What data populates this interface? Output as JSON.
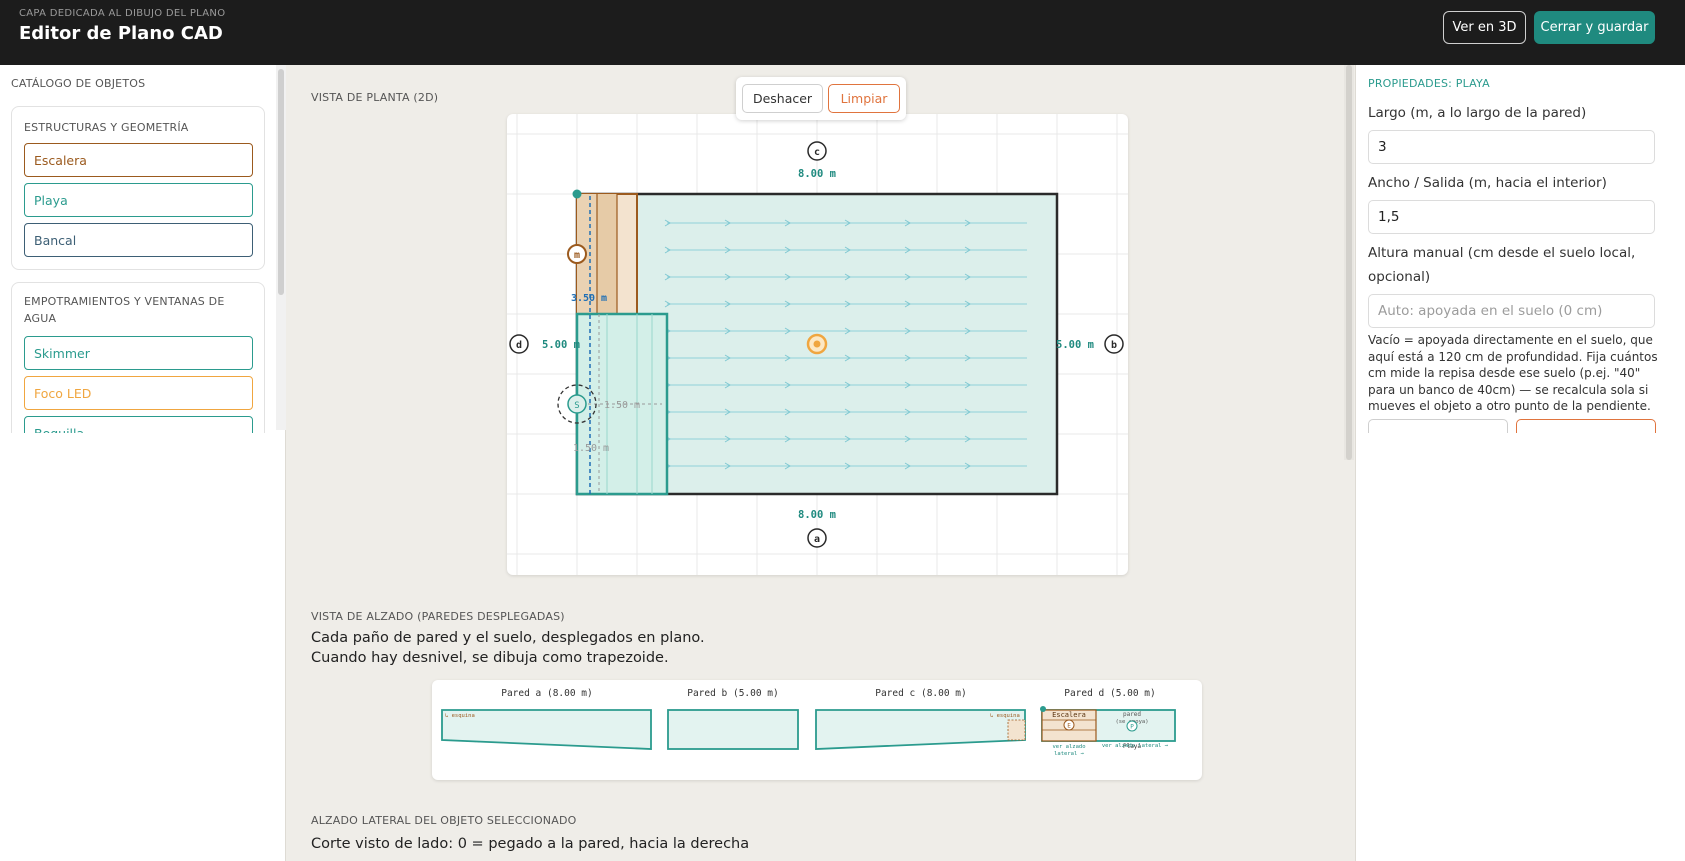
{
  "header": {
    "subtitle": "CAPA DEDICADA AL DIBUJO DEL PLANO",
    "title": "Editor de Plano CAD",
    "view_3d_label": "Ver en 3D",
    "save_label": "Cerrar y guardar"
  },
  "catalog": {
    "title": "CATÁLOGO DE OBJETOS",
    "groups": [
      {
        "title": "ESTRUCTURAS Y GEOMETRÍA",
        "items": [
          {
            "label": "Escalera",
            "color": "#9b5a1e"
          },
          {
            "label": "Playa",
            "color": "#2b9b8e"
          },
          {
            "label": "Bancal",
            "color": "#3d5f75"
          }
        ]
      },
      {
        "title": "EMPOTRAMIENTOS Y VENTANAS DE AGUA",
        "items": [
          {
            "label": "Skimmer",
            "color": "#2b9b8e"
          },
          {
            "label": "Foco LED",
            "color": "#f0a640"
          },
          {
            "label": "Boquilla",
            "color": "#2b9b8e"
          }
        ]
      }
    ]
  },
  "plan": {
    "section_label": "VISTA DE PLANTA (2D)",
    "undo_label": "Deshacer",
    "clear_label": "Limpiar",
    "dim_top": "8.00 m",
    "dim_bottom": "8.00 m",
    "dim_left": "5.00 m",
    "dim_right": "5.00 m",
    "wall_a": "a",
    "wall_b": "b",
    "wall_c": "c",
    "wall_d": "d",
    "stair_marker": "m",
    "stair_length": "3.50 m",
    "beach_width": "1.50 m",
    "beach_length": "1.50 m",
    "skimmer_marker": "S",
    "colors": {
      "water": "#dcefeb",
      "beach": "#2b9b8e",
      "stair": "#9b5a1e",
      "light": "#f0a640"
    }
  },
  "elevation": {
    "section_label": "VISTA DE ALZADO (PAREDES DESPLEGADAS)",
    "description": "Cada paño de pared y el suelo, desplegados en plano. Cuando hay desnivel, se dibuja como trapezoide.",
    "walls": [
      {
        "label": "Pared a (8.00 m)"
      },
      {
        "label": "Pared b (5.00 m)"
      },
      {
        "label": "Pared c (8.00 m)"
      },
      {
        "label": "Pared d (5.00 m)"
      }
    ],
    "corner_note_a": "↳ esquina",
    "corner_note_c": "↳ esquina",
    "corner_note_d": "↳ esquina",
    "d_stair_label": "Escalera",
    "d_stair_marker": "E",
    "d_wall_label": "pared",
    "d_wall_sub": "(se apoya)",
    "d_beach_marker": "P",
    "d_beach_label": "Playa",
    "d_link_left": "ver alzado",
    "d_link_left_2": "lateral →",
    "d_link_right": "ver alzado lateral →"
  },
  "side_elevation": {
    "section_label": "ALZADO LATERAL DEL OBJETO SELECCIONADO",
    "description": "Corte visto de lado: 0 = pegado a la pared, hacia la derecha ="
  },
  "properties": {
    "title": "PROPIEDADES: PLAYA",
    "length_label": "Largo (m, a lo largo de la pared)",
    "length_value": "3",
    "width_label": "Ancho / Salida (m, hacia el interior)",
    "width_value": "1,5",
    "height_label": "Altura manual (cm desde el suelo local, opcional)",
    "height_placeholder": "Auto: apoyada en el suelo (0 cm)",
    "help": "Vacío = apoyada directamente en el suelo, que aquí está a 120 cm de profundidad. Fija cuántos cm mide la repisa desde ese suelo (p.ej. \"40\" para un banco de 40cm) — se recalcula sola si mueves el objeto a otro punto de la pendiente."
  }
}
